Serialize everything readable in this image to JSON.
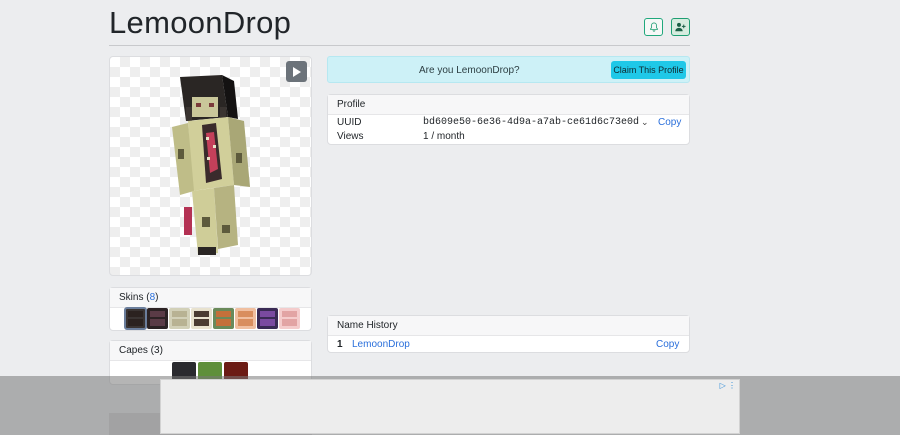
{
  "page": {
    "title": "LemoonDrop"
  },
  "header": {
    "bell_icon": "bell-icon",
    "user_icon": "user-plus-icon"
  },
  "viewer": {
    "play_icon": "play-icon"
  },
  "skins": {
    "label": "Skins (",
    "count": "8",
    "close": ")",
    "thumbs": [
      {
        "bg": "#3a3433",
        "face": "#2b2220",
        "active": true
      },
      {
        "bg": "#2c2224",
        "face": "#5a3b46",
        "active": false
      },
      {
        "bg": "#d2d0b8",
        "face": "#b8b293",
        "active": false
      },
      {
        "bg": "#e8e2cf",
        "face": "#4a3b32",
        "active": false
      },
      {
        "bg": "#6a8a5a",
        "face": "#c4703a",
        "active": false
      },
      {
        "bg": "#f0bfa0",
        "face": "#d98e5e",
        "active": false
      },
      {
        "bg": "#3a2a55",
        "face": "#7a4aa0",
        "active": false
      },
      {
        "bg": "#f4cccc",
        "face": "#e2a4a4",
        "active": false
      }
    ]
  },
  "capes": {
    "label": "Capes (3)",
    "items": [
      {
        "color": "#2a2a2f"
      },
      {
        "color": "#5f8f3a"
      },
      {
        "color": "#6b1b14"
      }
    ]
  },
  "claim": {
    "question": "Are you LemoonDrop?",
    "button": "Claim This Profile"
  },
  "profile": {
    "heading": "Profile",
    "uuid_label": "UUID",
    "uuid": "bd609e50-6e36-4d9a-a7ab-ce61d6c73e0d",
    "copy": "Copy",
    "views_label": "Views",
    "views": "1 / month"
  },
  "name_history": {
    "heading": "Name History",
    "entries": [
      {
        "index": "1",
        "name": "LemoonDrop",
        "copy": "Copy"
      }
    ]
  },
  "colors": {
    "accent": "#1fc8e8",
    "link": "#2a6fdb",
    "alert_bg": "#cdf1f7"
  }
}
